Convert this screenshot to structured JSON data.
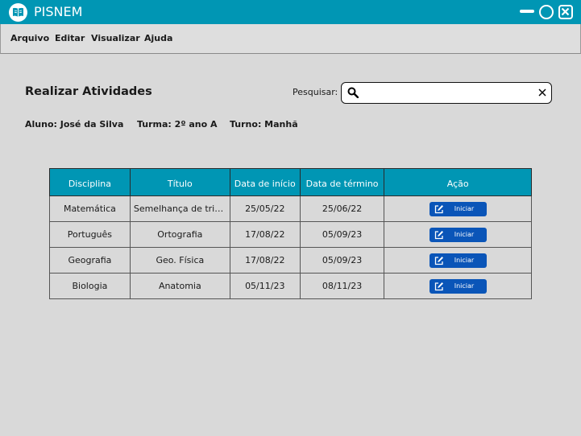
{
  "app": {
    "title": "PISNEM",
    "logo_icon": "book-icon"
  },
  "colors": {
    "titlebar": "#0096b4",
    "table_header": "#0096b4",
    "button": "#0a55b8",
    "background": "#d9d9d9"
  },
  "menu": {
    "items": [
      "Arquivo",
      "Editar",
      "Visualizar",
      "Ajuda"
    ]
  },
  "page": {
    "title": "Realizar Atividades"
  },
  "search": {
    "label": "Pesquisar:",
    "value": "",
    "placeholder": ""
  },
  "info": {
    "student": "Aluno: José da Silva",
    "class": "Turma: 2º ano A",
    "shift": "Turno: Manhã"
  },
  "table": {
    "headers": [
      "Disciplina",
      "Título",
      "Data de início",
      "Data de término",
      "Ação"
    ],
    "rows": [
      {
        "discipline": "Matemática",
        "title": "Semelhança de triângulos",
        "start": "25/05/22",
        "end": "25/06/22",
        "action": "Iniciar"
      },
      {
        "discipline": "Português",
        "title": "Ortografia",
        "start": "17/08/22",
        "end": "05/09/23",
        "action": "Iniciar"
      },
      {
        "discipline": "Geografia",
        "title": "Geo. Física",
        "start": "17/08/22",
        "end": "05/09/23",
        "action": "Iniciar"
      },
      {
        "discipline": "Biologia",
        "title": "Anatomia",
        "start": "05/11/23",
        "end": "08/11/23",
        "action": "Iniciar"
      }
    ]
  }
}
